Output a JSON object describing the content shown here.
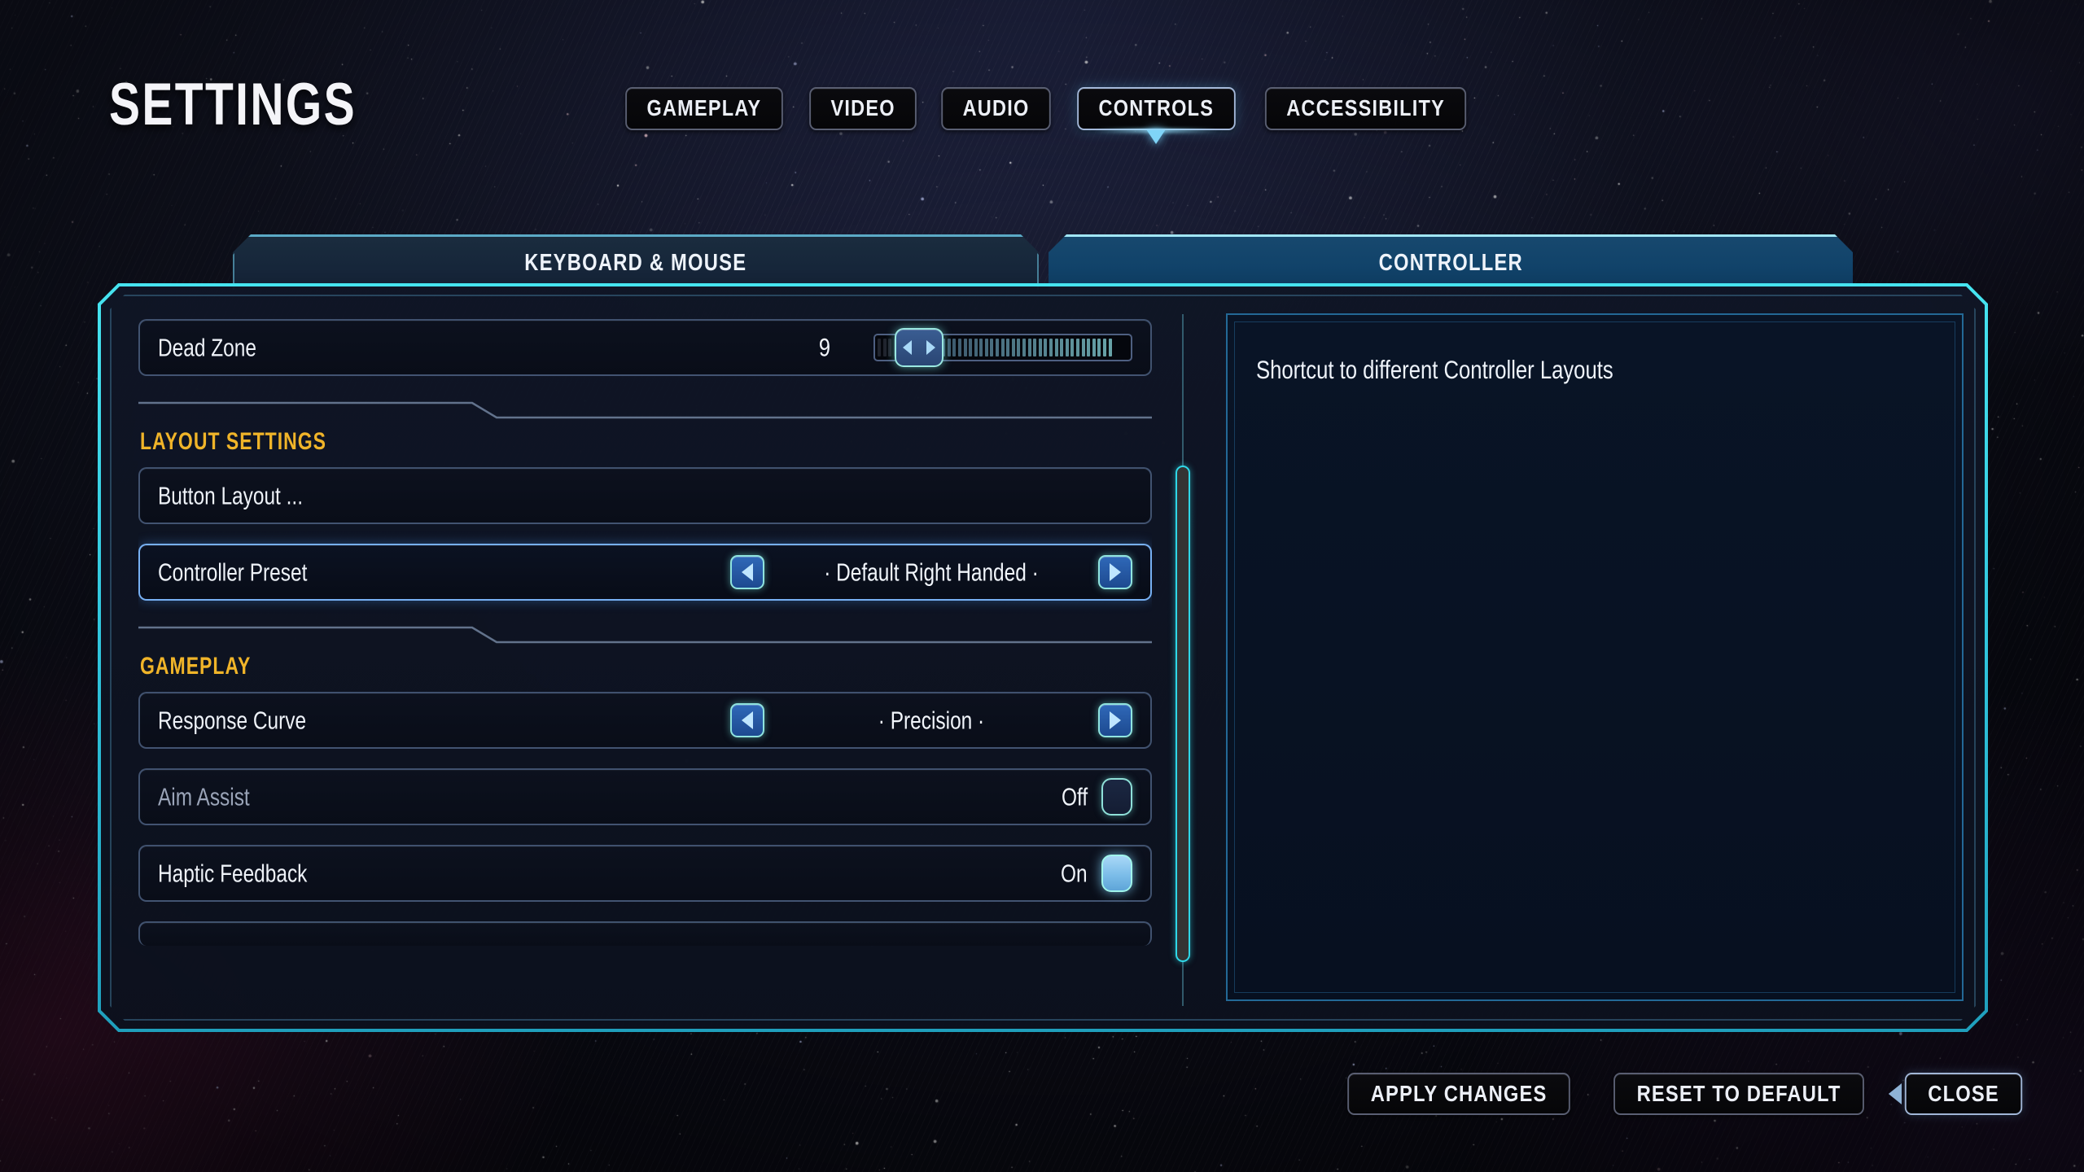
{
  "page": {
    "title": "SETTINGS"
  },
  "top_tabs": [
    {
      "label": "GAMEPLAY",
      "active": false
    },
    {
      "label": "VIDEO",
      "active": false
    },
    {
      "label": "AUDIO",
      "active": false
    },
    {
      "label": "CONTROLS",
      "active": true
    },
    {
      "label": "ACCESSIBILITY",
      "active": false
    }
  ],
  "sub_tabs": [
    {
      "label": "KEYBOARD & MOUSE",
      "active": false
    },
    {
      "label": "CONTROLLER",
      "active": true
    }
  ],
  "settings_rows": [
    {
      "type": "slider",
      "label": "Dead Zone",
      "value": "9",
      "slider": {
        "value": 9,
        "min": 0,
        "max": 100,
        "segments": 44,
        "filled_from": 5
      },
      "selected": false,
      "dim": false
    },
    {
      "type": "section",
      "label": "LAYOUT SETTINGS"
    },
    {
      "type": "action",
      "label": "Button Layout ...",
      "selected": false,
      "dim": false
    },
    {
      "type": "selector",
      "label": "Controller Preset",
      "value": "· Default Right Handed ·",
      "selected": true,
      "dim": false
    },
    {
      "type": "section",
      "label": "GAMEPLAY"
    },
    {
      "type": "selector",
      "label": "Response Curve",
      "value": "· Precision ·",
      "selected": false,
      "dim": false
    },
    {
      "type": "toggle",
      "label": "Aim Assist",
      "value": "Off",
      "on": false,
      "selected": false,
      "dim": true
    },
    {
      "type": "toggle",
      "label": "Haptic Feedback",
      "value": "On",
      "on": true,
      "selected": false,
      "dim": false
    },
    {
      "type": "partial",
      "label": ""
    }
  ],
  "info_panel": {
    "text": "Shortcut to different Controller Layouts"
  },
  "footer_buttons": [
    {
      "label": "APPLY CHANGES",
      "accent": false,
      "back_arrow": false
    },
    {
      "label": "RESET TO DEFAULT",
      "accent": false,
      "back_arrow": false
    },
    {
      "label": "CLOSE",
      "accent": true,
      "back_arrow": true
    }
  ],
  "colors": {
    "accent_cyan": "#2fd8e8",
    "accent_blue": "#2f68b8",
    "section_amber": "#f0b429",
    "text_primary": "#eef2f8",
    "text_dim": "#9aa4b8",
    "panel_bg": "#101626"
  }
}
